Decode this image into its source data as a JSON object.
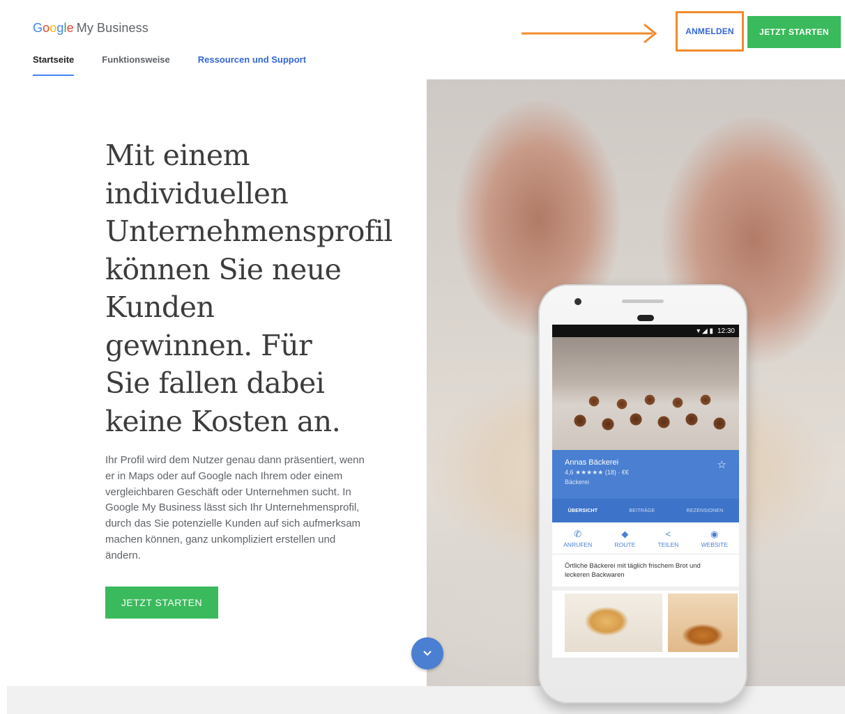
{
  "header": {
    "logo_google": [
      "G",
      "o",
      "o",
      "g",
      "l",
      "e"
    ],
    "logo_product": "My Business",
    "login_label": "ANMELDEN",
    "cta_label": "JETZT STARTEN",
    "highlight_color": "#f28b2b"
  },
  "nav": {
    "items": [
      {
        "label": "Startseite"
      },
      {
        "label": "Funktionsweise"
      },
      {
        "label": "Ressourcen und Support"
      }
    ]
  },
  "hero": {
    "headline_lines": [
      "Mit einem",
      "individuellen",
      "Unternehmensprofil",
      "können Sie neue",
      "Kunden",
      "gewinnen. Für",
      "Sie fallen dabei",
      "keine Kosten an."
    ],
    "body": "Ihr Profil wird dem Nutzer genau dann präsentiert, wenn er in Maps oder auf Google nach Ihrem oder einem vergleichbaren Geschäft oder Unternehmen sucht. In Google My Business lässt sich Ihr Unternehmensprofil, durch das Sie potenzielle Kunden auf sich aufmerksam machen können, ganz unkompliziert erstellen und ändern.",
    "cta_label": "JETZT STARTEN",
    "accent_green": "#3aba5c",
    "accent_blue": "#4a7fd1"
  },
  "phone": {
    "status_time": "12:30",
    "status_icons": "▾ ◢ ▮",
    "business_name": "Annas Bäckerei",
    "rating_line": "4,6 ★★★★★ (18) · €€",
    "category": "Bäckerei",
    "star_icon": "☆",
    "tabs": [
      "ÜBERSICHT",
      "BEITRÄGE",
      "REZENSIONEN"
    ],
    "actions": [
      {
        "icon": "✆",
        "label": "ANRUFEN"
      },
      {
        "icon": "◆",
        "label": "ROUTE"
      },
      {
        "icon": "<",
        "label": "TEILEN"
      },
      {
        "icon": "◉",
        "label": "WEBSITE"
      }
    ],
    "description": "Örtliche Bäckerei mit täglich frischem Brot und leckeren Backwaren"
  }
}
